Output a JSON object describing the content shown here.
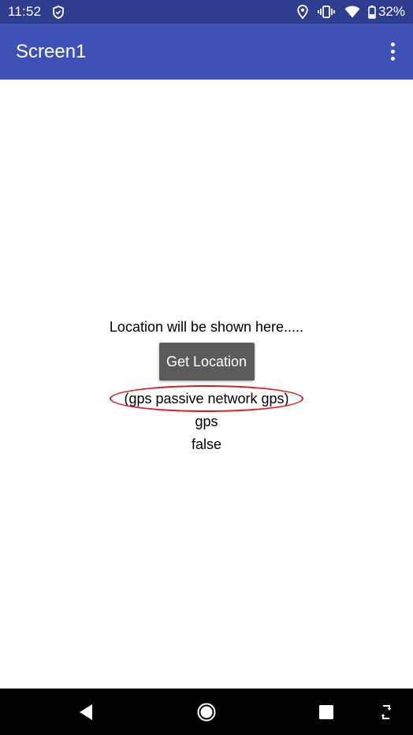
{
  "status_bar": {
    "time": "11:52",
    "battery_percent": "32%",
    "icons": [
      "shield-icon",
      "location-pin-icon",
      "vibrate-icon",
      "wifi-icon",
      "battery-icon"
    ]
  },
  "app_bar": {
    "title": "Screen1",
    "menu_icon": "overflow-menu-icon"
  },
  "main": {
    "location_label": "Location will be shown here.....",
    "get_location_button": "Get Location",
    "providers_label": "(gps passive network gps)",
    "provider_label": "gps",
    "enabled_label": "false",
    "highlight_color": "#d11a23"
  },
  "nav_bar": {
    "icons": [
      "back-icon",
      "home-icon",
      "recents-icon",
      "rotate-icon"
    ]
  },
  "colors": {
    "status_bar": "#2f3d8f",
    "app_bar": "#3f51b5",
    "button": "#5b5b5b",
    "nav_bar": "#000000"
  }
}
